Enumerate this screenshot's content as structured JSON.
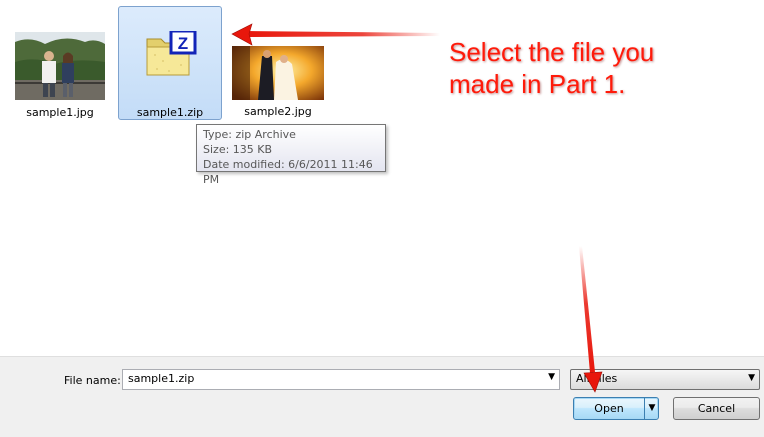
{
  "files": [
    {
      "name": "sample1.jpg",
      "icon": "photo-thumbnail-icon",
      "selected": false
    },
    {
      "name": "sample1.zip",
      "icon": "zip-archive-icon",
      "selected": true
    },
    {
      "name": "sample2.jpg",
      "icon": "photo-thumbnail-icon",
      "selected": false
    }
  ],
  "tooltip": {
    "type": "Type: zip Archive",
    "size": "Size: 135 KB",
    "modified": "Date modified: 6/6/2011 11:46 PM"
  },
  "annotation": {
    "line1": "Select the file you",
    "line2": "made in Part 1."
  },
  "footer": {
    "filename_label": "File name:",
    "filename_value": "sample1.zip",
    "filetype_value": "All Files",
    "open_label": "Open",
    "cancel_label": "Cancel"
  },
  "colors": {
    "selection": "#cce0f8",
    "annotation": "#ff1a0a",
    "arrow": "#e8170c"
  }
}
